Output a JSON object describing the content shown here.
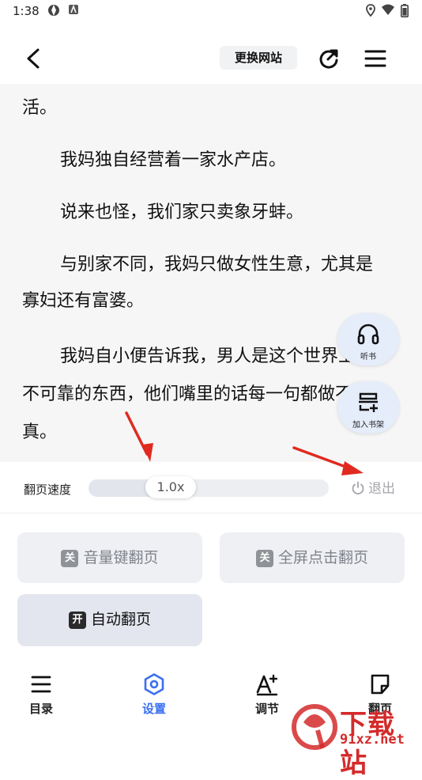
{
  "status_bar": {
    "time": "1:38"
  },
  "toolbar": {
    "switch_site_label": "更换网站"
  },
  "reader": {
    "paragraphs": {
      "p0": "活。",
      "p1": "我妈独自经营着一家水产店。",
      "p2": "说来也怪，我们家只卖象牙蚌。",
      "p3a": "与别家不同，我妈只做女性生意，尤其是",
      "p3b": "寡妇还有富婆。",
      "p4a": "我妈自小便告诉我，男人是这个世界上最",
      "p4b": "不可靠的东西，他们嘴里的话每一句都做不得",
      "p4c": "真。"
    },
    "float_listen_label": "听书",
    "float_bookshelf_label": "加入书架"
  },
  "speed": {
    "label": "翻页速度",
    "value_text": "1.0x",
    "level": 0.3,
    "exit_label": "退出"
  },
  "options": {
    "volume_key": {
      "tag": "关",
      "label": "音量键翻页"
    },
    "fullscreen_tap": {
      "tag": "关",
      "label": "全屏点击翻页"
    },
    "auto_page": {
      "tag": "开",
      "label": "自动翻页"
    }
  },
  "bottom_nav": {
    "contents": "目录",
    "settings": "设置",
    "adjust": "调节",
    "page_turn": "翻页"
  },
  "watermark": {
    "text": "下载站",
    "url": "91xz.net"
  },
  "colors": {
    "accent": "#3a6ff2",
    "arrow": "#e02a20",
    "panel_button": "#eef0f4"
  }
}
